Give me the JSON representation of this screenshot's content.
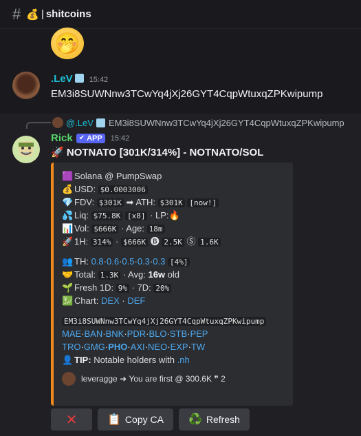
{
  "channel": {
    "icon": "hash-icon",
    "prefix_emoji": "💰",
    "separator": "|",
    "name": "shitcoins"
  },
  "reaction_emoji": "🤭",
  "message1": {
    "author": ".LeV",
    "time": "15:42",
    "text": "EM3i8SUWNnw3TCwYq4jXj26GYT4CqpWtuxqZPKwipump"
  },
  "reply": {
    "author": "@.LeV",
    "text": "EM3i8SUWNnw3TCwYq4jXj26GYT4CqpWtuxqZPKwipump"
  },
  "message2": {
    "author": "Rick",
    "badge": "APP",
    "time": "15:42",
    "title_emoji": "🚀",
    "title": "NOTNATO [301K/314%] - NOTNATO/SOL"
  },
  "embed": {
    "accent_color": "#f08a1a",
    "chain": {
      "emoji": "🟪",
      "text": "Solana @ PumpSwap"
    },
    "usd": {
      "emoji": "💰",
      "label": "USD:",
      "value": "$0.0003006"
    },
    "fdv": {
      "emoji": "💎",
      "label": "FDV:",
      "value": "$301K",
      "arrow": "➡",
      "ath_label": "ATH:",
      "ath_value": "$301K",
      "ath_tag": "[now!]"
    },
    "liq": {
      "emoji": "💦",
      "label": "Liq:",
      "value": "$75.8K",
      "mult": "[x8]",
      "lp_label": "· LP:",
      "lp_emoji": "🔥"
    },
    "vol": {
      "emoji": "📊",
      "label": "Vol:",
      "value": "$666K",
      "age_label": "· Age:",
      "age_value": "18m"
    },
    "h1": {
      "emoji": "🚀",
      "label": "1H:",
      "pct": "314%",
      "sep1": "·",
      "vol": "$666K",
      "buy_icon": "🅑",
      "buys": "2.5K",
      "sell_icon": "Ⓢ",
      "sells": "1.6K"
    },
    "th": {
      "emoji": "👥",
      "label": "TH:",
      "values": [
        "0.8",
        "0.6",
        "0.5",
        "0.3",
        "0.3"
      ],
      "total_pct": "[4%]"
    },
    "total": {
      "emoji": "🤝",
      "label": "Total:",
      "value": "1.3K",
      "avg_label": "· Avg:",
      "avg_value": "16w",
      "suffix": "old"
    },
    "fresh": {
      "emoji": "🌱",
      "label": "Fresh 1D:",
      "d1": "9%",
      "d7_label": "· 7D:",
      "d7": "20%"
    },
    "chart": {
      "emoji": "💹",
      "label": "Chart:",
      "links": [
        "DEX",
        "DEF"
      ]
    },
    "address": "EM3i8SUWNnw3TCwYq4jXj26GYT4CqpWtuxqZPKwipump",
    "links_row1": [
      "MAE",
      "BAN",
      "BNK",
      "PDR",
      "BLO",
      "STB",
      "PEP"
    ],
    "links_row2": [
      "TRO",
      "GMG",
      "PHO",
      "AXI",
      "NEO",
      "EXP",
      "TW"
    ],
    "tip": {
      "emoji": "👤",
      "label": "TIP:",
      "text": "Notable holders with",
      "link": ".nh"
    },
    "footer": {
      "user": "leveragge",
      "arrow": "➜",
      "text": "You are first @ 300.6K",
      "quote_icon": "❞",
      "count": "2"
    }
  },
  "buttons": {
    "dismiss": "✕",
    "copy_ca": {
      "icon": "📋",
      "label": "Copy CA"
    },
    "refresh": {
      "icon": "♻️",
      "label": "Refresh"
    }
  }
}
